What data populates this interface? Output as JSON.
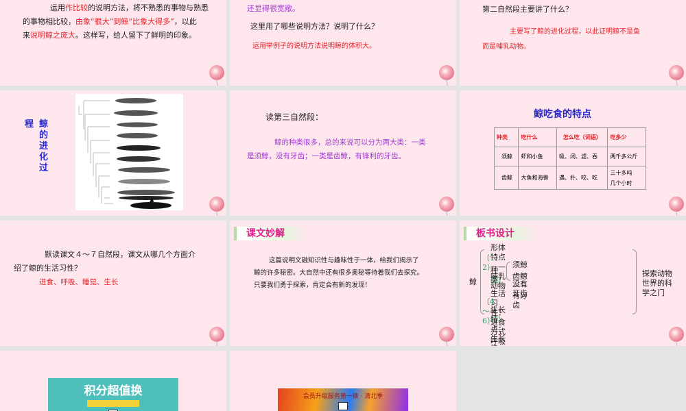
{
  "slide1": {
    "line1_a": "运用",
    "line1_b": "作比较",
    "line1_c": "的说明方法，将不熟悉的事物与熟悉",
    "line2_a": "的事物相比较，",
    "line2_b": "由象“很大”到鲸“比象大得多”",
    "line2_c": "，以此",
    "line3_a": "来",
    "line3_b": "说明鲸之庞大",
    "line3_c": "。这样写，给人留下了鲜明的印象。"
  },
  "slide2": {
    "cut_text": "还显得很宽敞。",
    "question": "这里用了哪些说明方法？说明了什么？",
    "answer": "运用举例子的说明方法说明鲸的体积大。"
  },
  "slide3": {
    "question": "第二自然段主要讲了什么？",
    "answer_1": "主要写了鲸的进化过程，以此证明鲸不是鱼",
    "answer_2": "而是哺乳动物。"
  },
  "slide4": {
    "title_col1": "鲸的进化过",
    "title_col2": "程"
  },
  "slide5": {
    "heading": "读第三自然段：",
    "para_1": "鲸的种类很多，总的来说可以分为两大类：一类",
    "para_2": "是须鲸，没有牙齿；一类是齿鲸，有锋利的牙齿。"
  },
  "slide6": {
    "title": "鲸吃食的特点",
    "headers": [
      "种类",
      "吃什么",
      "怎么吃（词语）",
      "吃多少"
    ],
    "rows": [
      [
        "须鲸",
        "虾和小鱼",
        "吸、闭、滤、吞",
        "两千多公斤"
      ],
      [
        "齿鲸",
        "大鱼和海兽",
        "遇、扑、咬、吃",
        "三十多吨",
        "几个小时"
      ]
    ]
  },
  "slide7": {
    "question_1": "默读课文４～７自然段，课文从哪几个方面介",
    "question_2": "绍了鲸的生活习性？",
    "answer": "进食、呼吸、睡觉、生长"
  },
  "slide8": {
    "banner": "课文妙解",
    "para_1": "这篇说明文融知识性与趣味性于一体，给我们揭示了",
    "para_2": "鲸的许多秘密。大自然中还有很多奥秘等待着我们去探究。",
    "para_3": "只要我们勇于探索，肯定会有新的发现！"
  },
  "slide9": {
    "banner": "板书设计",
    "root": "鲸",
    "l1": "形体特点——哺乳动物",
    "p1": "（1、2）",
    "kind": "种类",
    "k1": "须鲸——没有牙齿",
    "k2": "齿鲸——有牙齿",
    "p3": "（3）",
    "l3": "生活习性：进食方式　呼吸用肺　睡觉特殊",
    "p4": "（4～6）",
    "l4": "生长特点：生长快　寿命长",
    "p7": "（7）",
    "conclusion": "探索动物世界的科学之门"
  },
  "slide10": {
    "ad_title": "积分超值换"
  },
  "slide11": {
    "ad_title": "会员升级服务第一拨 · 清北季"
  }
}
